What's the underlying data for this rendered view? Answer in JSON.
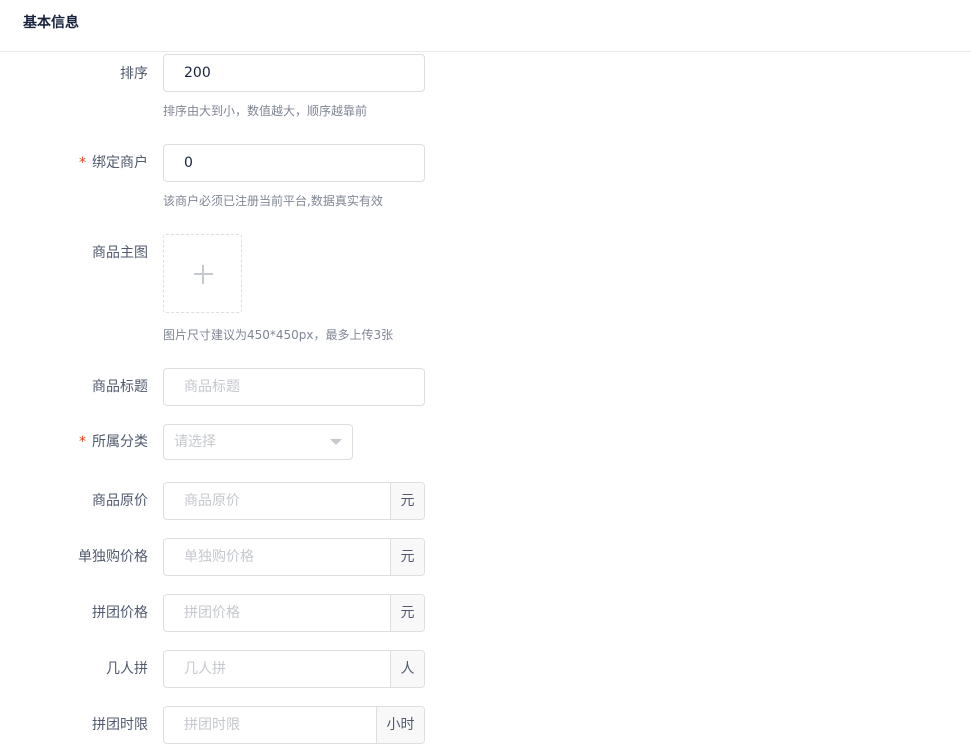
{
  "section_title": "基本信息",
  "fields": {
    "sort": {
      "label": "排序",
      "value": "200",
      "hint": "排序由大到小，数值越大，顺序越靠前"
    },
    "merchant": {
      "required_mark": "*",
      "label": "绑定商户",
      "value": "0",
      "hint": "该商户必须已注册当前平台,数据真实有效"
    },
    "main_image": {
      "label": "商品主图",
      "upload_icon": "plus-icon",
      "hint": "图片尺寸建议为450*450px，最多上传3张"
    },
    "title": {
      "label": "商品标题",
      "placeholder": "商品标题"
    },
    "category": {
      "required_mark": "*",
      "label": "所属分类",
      "placeholder": "请选择",
      "icon": "chevron-down-icon"
    },
    "original_price": {
      "label": "商品原价",
      "placeholder": "商品原价",
      "unit": "元"
    },
    "single_price": {
      "label": "单独购价格",
      "placeholder": "单独购价格",
      "unit": "元"
    },
    "group_price": {
      "label": "拼团价格",
      "placeholder": "拼团价格",
      "unit": "元"
    },
    "group_size": {
      "label": "几人拼",
      "placeholder": "几人拼",
      "unit": "人"
    },
    "group_time_limit": {
      "label": "拼团时限",
      "placeholder": "拼团时限",
      "unit": "小时"
    }
  }
}
